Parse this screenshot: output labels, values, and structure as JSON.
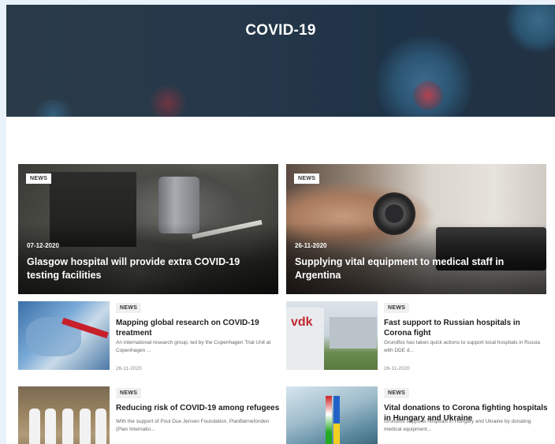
{
  "hero": {
    "title": "COVID-19"
  },
  "featured": [
    {
      "tag": "NEWS",
      "date": "07-12-2020",
      "title": "Glasgow hospital will provide extra COVID-19 testing facilities"
    },
    {
      "tag": "NEWS",
      "date": "26-11-2020",
      "title": "Supplying vital equipment to medical staff in Argentina"
    }
  ],
  "items": [
    {
      "tag": "NEWS",
      "title": "Mapping global research on COVID-19 treatment",
      "description": "An international research group, led by the Copenhagen Trial Unit at Copenhagen ...",
      "date": "26-11-2020"
    },
    {
      "tag": "NEWS",
      "title": "Fast support to Russian hospitals in Corona fight",
      "description": "Grundfos has taken quick actions to support local hospitals in Russia with DDE d...",
      "date": "26-11-2020"
    },
    {
      "tag": "NEWS",
      "title": "Reducing risk of COVID-19 among refugees",
      "description": "With the support of Poul Due Jensen Foundation, PlanBørnefonden (Plan Internatio...",
      "date": ""
    },
    {
      "tag": "NEWS",
      "title": "Vital donations to Corona fighting hospitals in Hungary and Ukraine",
      "description": "Grundfos supports hospitals in Hungary and Ukraine by donating medical equipment...",
      "date": ""
    }
  ],
  "thumb_labels": {
    "vdk": "vdk"
  }
}
